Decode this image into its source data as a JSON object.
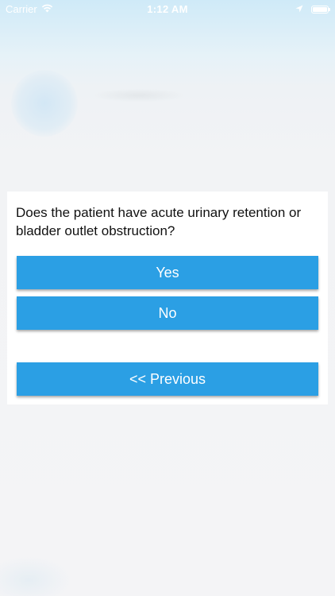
{
  "status_bar": {
    "carrier": "Carrier",
    "time": "1:12 AM",
    "icons": [
      "wifi-icon",
      "location-arrow-icon",
      "battery-icon"
    ]
  },
  "dialog": {
    "question": "Does the patient have acute urinary retention or bladder outlet obstruction?",
    "yes_label": "Yes",
    "no_label": "No",
    "previous_label": "<< Previous"
  },
  "colors": {
    "button": "#2b9fe4",
    "button_text": "#ffffff",
    "card": "#ffffff",
    "status_text": "#ffffff"
  }
}
